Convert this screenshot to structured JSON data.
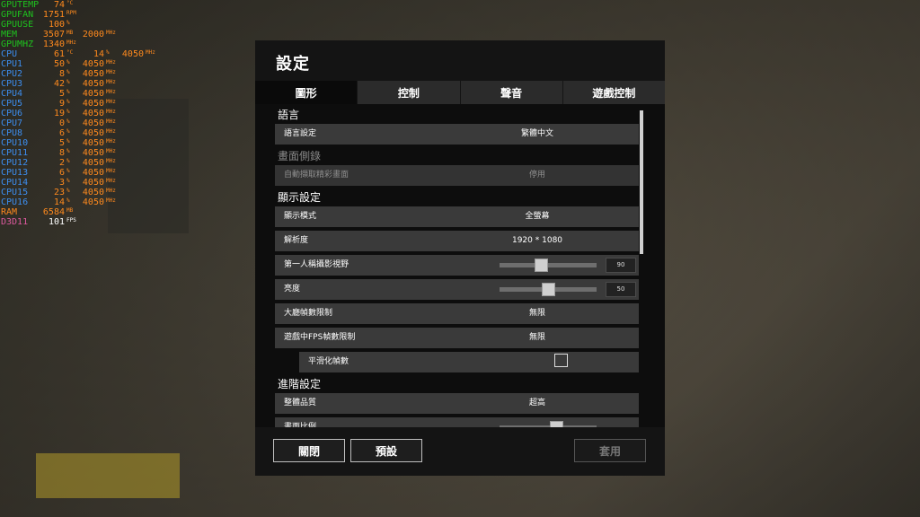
{
  "osd": {
    "rows": [
      {
        "label": "GPUTEMP",
        "v1": "74",
        "u1": "°C",
        "v2": "",
        "u2": "",
        "v3": "",
        "u3": "",
        "color": "gpu"
      },
      {
        "label": "GPUFAN",
        "v1": "1751",
        "u1": "RPM",
        "v2": "",
        "u2": "",
        "v3": "",
        "u3": "",
        "color": "gpu"
      },
      {
        "label": "GPUUSE",
        "v1": "100",
        "u1": "%",
        "v2": "",
        "u2": "",
        "v3": "",
        "u3": "",
        "color": "gpu"
      },
      {
        "label": "MEM",
        "v1": "3507",
        "u1": "MB",
        "v2": "2000",
        "u2": "MHz",
        "v3": "",
        "u3": "",
        "color": "gpu"
      },
      {
        "label": "GPUMHZ",
        "v1": "1340",
        "u1": "MHz",
        "v2": "",
        "u2": "",
        "v3": "",
        "u3": "",
        "color": "gpu"
      },
      {
        "label": "CPU",
        "v1": "61",
        "u1": "°C",
        "v2": "14",
        "u2": "%",
        "v3": "4050",
        "u3": "MHz",
        "color": "cpu"
      },
      {
        "label": "CPU1",
        "v1": "50",
        "u1": "%",
        "v2": "4050",
        "u2": "MHz",
        "v3": "",
        "u3": "",
        "color": "cpu"
      },
      {
        "label": "CPU2",
        "v1": "8",
        "u1": "%",
        "v2": "4050",
        "u2": "MHz",
        "v3": "",
        "u3": "",
        "color": "cpu"
      },
      {
        "label": "CPU3",
        "v1": "42",
        "u1": "%",
        "v2": "4050",
        "u2": "MHz",
        "v3": "",
        "u3": "",
        "color": "cpu"
      },
      {
        "label": "CPU4",
        "v1": "5",
        "u1": "%",
        "v2": "4050",
        "u2": "MHz",
        "v3": "",
        "u3": "",
        "color": "cpu"
      },
      {
        "label": "CPU5",
        "v1": "9",
        "u1": "%",
        "v2": "4050",
        "u2": "MHz",
        "v3": "",
        "u3": "",
        "color": "cpu"
      },
      {
        "label": "CPU6",
        "v1": "19",
        "u1": "%",
        "v2": "4050",
        "u2": "MHz",
        "v3": "",
        "u3": "",
        "color": "cpu"
      },
      {
        "label": "CPU7",
        "v1": "0",
        "u1": "%",
        "v2": "4050",
        "u2": "MHz",
        "v3": "",
        "u3": "",
        "color": "cpu"
      },
      {
        "label": "CPU8",
        "v1": "6",
        "u1": "%",
        "v2": "4050",
        "u2": "MHz",
        "v3": "",
        "u3": "",
        "color": "cpu"
      },
      {
        "label": "CPU10",
        "v1": "5",
        "u1": "%",
        "v2": "4050",
        "u2": "MHz",
        "v3": "",
        "u3": "",
        "color": "cpu"
      },
      {
        "label": "CPU11",
        "v1": "8",
        "u1": "%",
        "v2": "4050",
        "u2": "MHz",
        "v3": "",
        "u3": "",
        "color": "cpu"
      },
      {
        "label": "CPU12",
        "v1": "2",
        "u1": "%",
        "v2": "4050",
        "u2": "MHz",
        "v3": "",
        "u3": "",
        "color": "cpu"
      },
      {
        "label": "CPU13",
        "v1": "6",
        "u1": "%",
        "v2": "4050",
        "u2": "MHz",
        "v3": "",
        "u3": "",
        "color": "cpu"
      },
      {
        "label": "CPU14",
        "v1": "3",
        "u1": "%",
        "v2": "4050",
        "u2": "MHz",
        "v3": "",
        "u3": "",
        "color": "cpu"
      },
      {
        "label": "CPU15",
        "v1": "23",
        "u1": "%",
        "v2": "4050",
        "u2": "MHz",
        "v3": "",
        "u3": "",
        "color": "cpu"
      },
      {
        "label": "CPU16",
        "v1": "14",
        "u1": "%",
        "v2": "4050",
        "u2": "MHz",
        "v3": "",
        "u3": "",
        "color": "cpu"
      },
      {
        "label": "RAM",
        "v1": "6584",
        "u1": "MB",
        "v2": "",
        "u2": "",
        "v3": "",
        "u3": "",
        "color": "ram"
      },
      {
        "label": "D3D11",
        "v1": "101",
        "u1": "FPS",
        "v2": "",
        "u2": "",
        "v3": "",
        "u3": "",
        "color": "d3d"
      }
    ]
  },
  "dialog": {
    "title": "設定",
    "tabs": [
      "圖形",
      "控制",
      "聲音",
      "遊戲控制"
    ],
    "active_tab": 0,
    "sections": {
      "language": "語言",
      "replay": "畫面側錄",
      "display": "顯示設定",
      "advanced": "進階設定"
    },
    "rows": {
      "language_setting": {
        "label": "語言設定",
        "value": "繁體中文"
      },
      "auto_capture": {
        "label": "自動擷取精彩畫面",
        "value": "停用"
      },
      "display_mode": {
        "label": "顯示模式",
        "value": "全螢幕"
      },
      "resolution": {
        "label": "解析度",
        "value": "1920 * 1080"
      },
      "fov": {
        "label": "第一人稱攝影視野",
        "value": "90",
        "level": 0.42
      },
      "brightness": {
        "label": "亮度",
        "value": "50",
        "level": 0.5
      },
      "lobby_fps": {
        "label": "大廳幀數限制",
        "value": "無限"
      },
      "ingame_fps": {
        "label": "遊戲中FPS幀數限制",
        "value": "無限"
      },
      "smooth_fps": {
        "label": "平滑化幀數",
        "checked": false
      },
      "overall_quality": {
        "label": "整體品質",
        "value": "超高"
      },
      "screen_scale": {
        "label": "畫面比例",
        "level": 0.6
      }
    },
    "buttons": {
      "close": "關閉",
      "default": "預設",
      "apply": "套用"
    }
  }
}
